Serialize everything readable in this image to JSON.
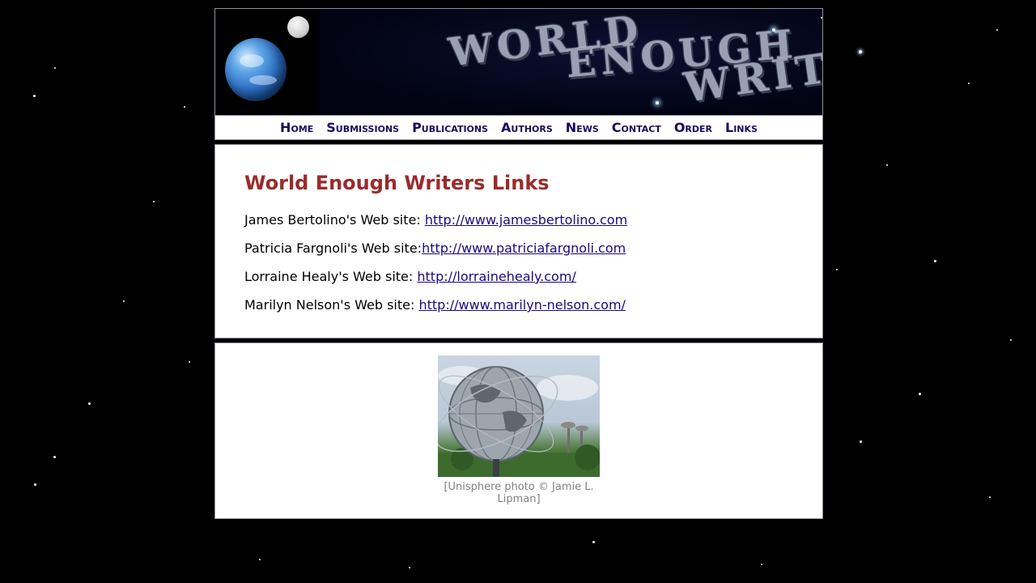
{
  "banner": {
    "title_words": [
      "WORLD",
      "ENOUGH",
      "WRITERS"
    ]
  },
  "nav": {
    "items": [
      {
        "label": "Home"
      },
      {
        "label": "Submissions"
      },
      {
        "label": "Publications"
      },
      {
        "label": "Authors"
      },
      {
        "label": "News"
      },
      {
        "label": "Contact"
      },
      {
        "label": "Order"
      },
      {
        "label": "Links"
      }
    ]
  },
  "main": {
    "title": "World Enough Writers Links",
    "links": [
      {
        "label": "James Bertolino's Web site: ",
        "url_text": "http://www.jamesbertolino.com"
      },
      {
        "label": "Patricia Fargnoli's Web site:",
        "url_text": "http://www.patriciafargnoli.com"
      },
      {
        "label": "Lorraine Healy's Web site: ",
        "url_text": "http://lorrainehealy.com/"
      },
      {
        "label": "Marilyn Nelson's Web site: ",
        "url_text": "http://www.marilyn-nelson.com/"
      }
    ]
  },
  "photo": {
    "caption": "[Unisphere photo © Jamie L. Lipman]"
  },
  "colors": {
    "background": "#000000",
    "title": "#9b2b2b",
    "nav_link": "#1a0a60",
    "link": "#1a0a80",
    "caption": "#808080",
    "panel_border": "#8f8f9f"
  }
}
